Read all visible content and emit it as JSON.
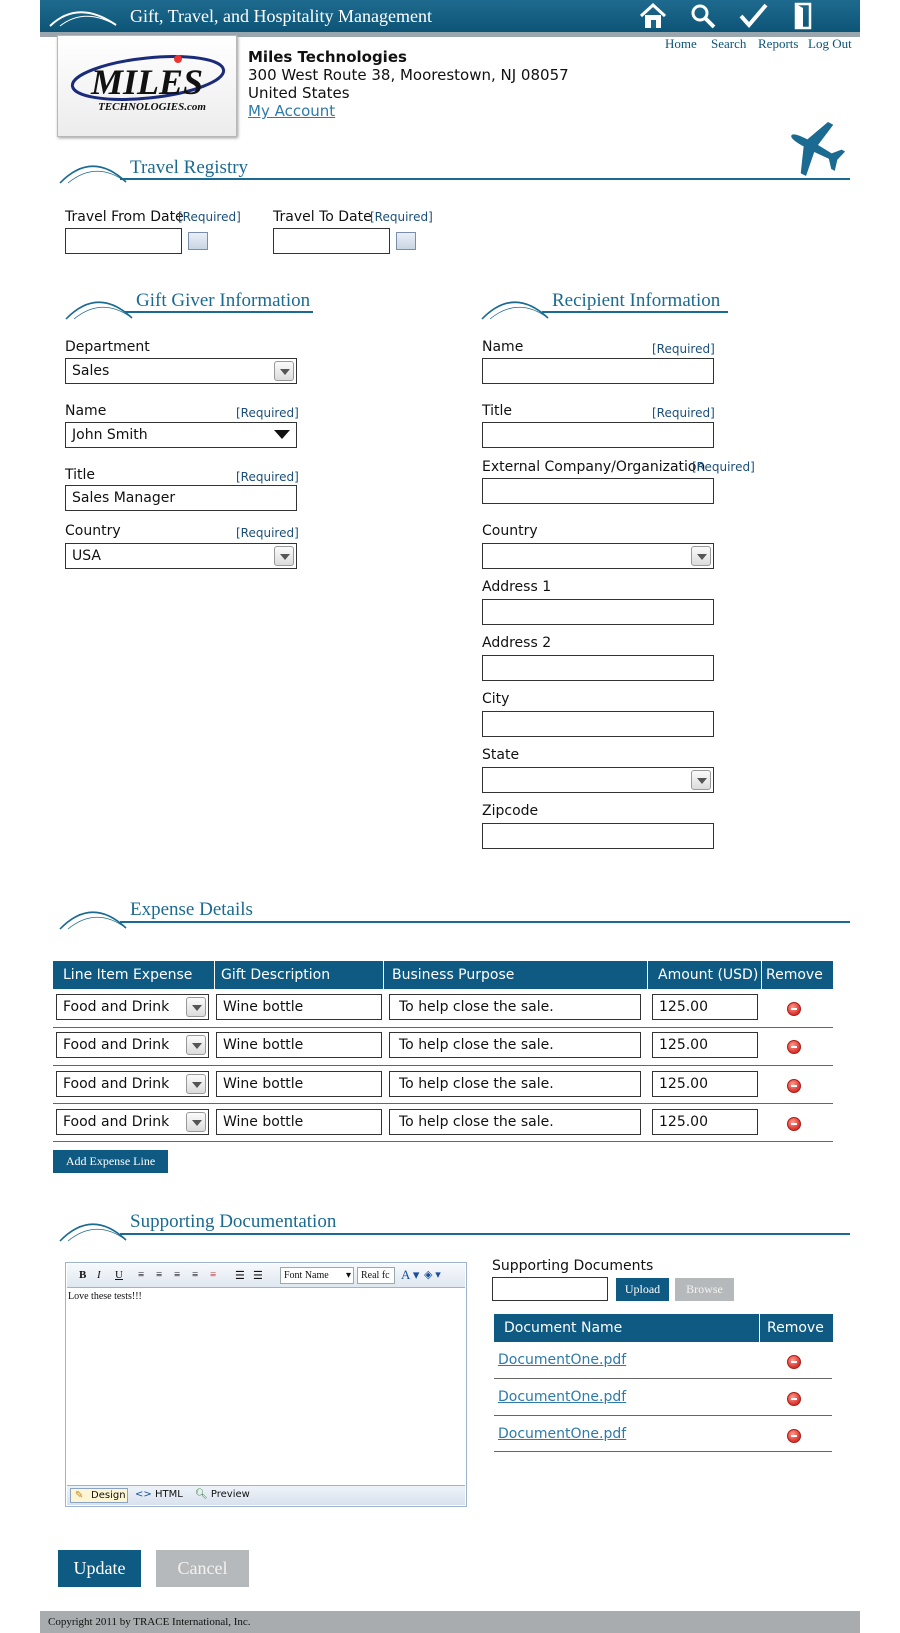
{
  "app": {
    "title": "Gift, Travel, and Hospitality Management"
  },
  "nav": {
    "home": "Home",
    "search": "Search",
    "reports": "Reports",
    "logout": "Log Out"
  },
  "logo": {
    "line1": "MILES",
    "line2": "TECHNOLOGIES.com"
  },
  "company": {
    "name": "Miles Technologies",
    "address": "300 West Route 38, Moorestown, NJ 08057",
    "country": "United States",
    "account_link": "My Account"
  },
  "travel": {
    "title": "Travel Registry",
    "from_label": "Travel From Date",
    "to_label": "Travel To Date",
    "required": "[Required]",
    "from_value": "",
    "to_value": ""
  },
  "giver": {
    "title": "Gift Giver Information",
    "department_label": "Department",
    "department_value": "Sales",
    "name_label": "Name",
    "name_value": "John Smith",
    "title_label": "Title",
    "title_value": "Sales Manager",
    "country_label": "Country",
    "country_value": "USA",
    "required": "[Required]"
  },
  "recipient": {
    "title": "Recipient Information",
    "name_label": "Name",
    "title_label": "Title",
    "org_label": "External Company/Organization",
    "country_label": "Country",
    "address1_label": "Address 1",
    "address2_label": "Address 2",
    "city_label": "City",
    "state_label": "State",
    "zip_label": "Zipcode",
    "required": "[Required]"
  },
  "expense": {
    "title": "Expense Details",
    "columns": [
      "Line Item Expense",
      "Gift Description",
      "Business Purpose",
      "Amount (USD)",
      "Remove"
    ],
    "rows": [
      {
        "type": "Food and Drink",
        "description": "Wine bottle",
        "purpose": "To help close the sale.",
        "amount": "125.00"
      },
      {
        "type": "Food and Drink",
        "description": "Wine bottle",
        "purpose": "To help close the sale.",
        "amount": "125.00"
      },
      {
        "type": "Food and Drink",
        "description": "Wine bottle",
        "purpose": "To help close the sale.",
        "amount": "125.00"
      },
      {
        "type": "Food and Drink",
        "description": "Wine bottle",
        "purpose": "To help close the sale.",
        "amount": "125.00"
      }
    ],
    "add_button": "Add Expense Line"
  },
  "docs": {
    "title": "Supporting Documentation",
    "editor_text": "Love these tests!!!",
    "font_name": "Font Name",
    "font_size": "Real fc",
    "mode_design": "Design",
    "mode_html": "HTML",
    "mode_preview": "Preview",
    "supporting_label": "Supporting Documents",
    "upload_button": "Upload",
    "browse_button": "Browse",
    "columns": [
      "Document Name",
      "Remove"
    ],
    "files": [
      "DocumentOne.pdf",
      "DocumentOne.pdf",
      "DocumentOne.pdf"
    ]
  },
  "actions": {
    "update": "Update",
    "cancel": "Cancel"
  },
  "footer": {
    "copyright": "Copyright 2011 by TRACE International, Inc."
  }
}
